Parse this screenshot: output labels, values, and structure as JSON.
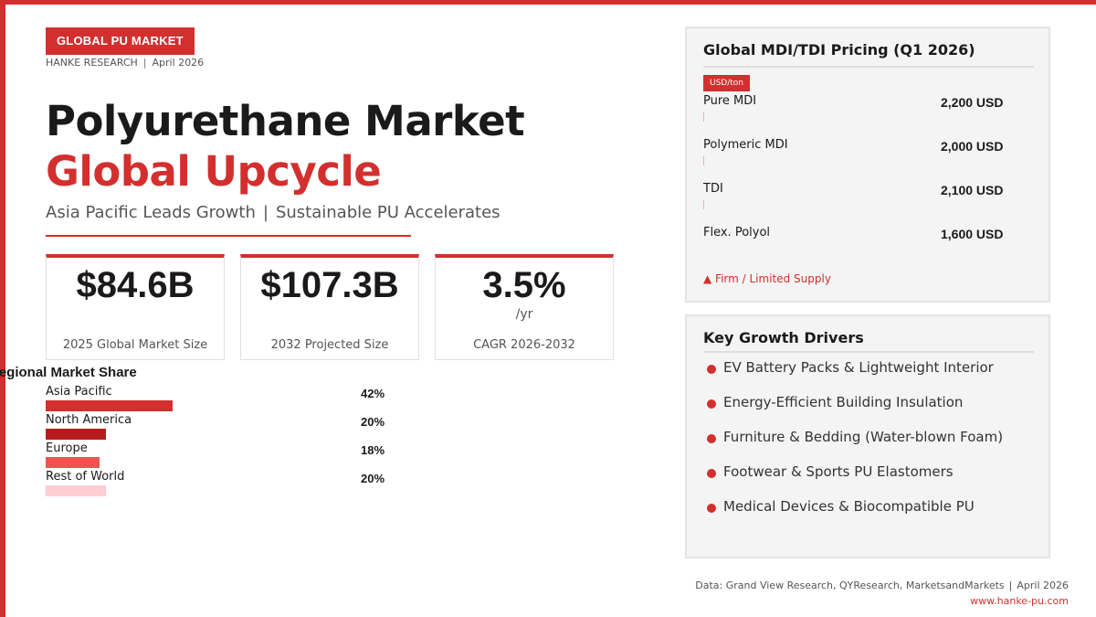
{
  "header": {
    "badge": "GLOBAL PU MARKET",
    "publisher": "HANKE RESEARCH",
    "separator": "|",
    "date": "April 2026"
  },
  "title": {
    "line1": "Polyurethane Market",
    "line2": "Global Upcycle",
    "tagline_left": "Asia Pacific Leads Growth",
    "tagline_sep": "|",
    "tagline_right": "Sustainable PU Accelerates"
  },
  "kpis": [
    {
      "value": "$84.6B",
      "unit": "",
      "label": "2025 Global Market Size"
    },
    {
      "value": "$107.3B",
      "unit": "",
      "label": "2032 Projected Size"
    },
    {
      "value": "3.5%",
      "unit": "/yr",
      "label": "CAGR 2026-2032"
    }
  ],
  "regional_share": {
    "title": "Regional Market Share",
    "regions": [
      {
        "name": "Asia Pacific",
        "share": 42,
        "label": "42%",
        "color": "#d32f2f"
      },
      {
        "name": "North America",
        "share": 20,
        "label": "20%",
        "color": "#b71c1c"
      },
      {
        "name": "Europe",
        "share": 18,
        "label": "18%",
        "color": "#ef5350"
      },
      {
        "name": "Rest of World",
        "share": 20,
        "label": "20%",
        "color": "#ffcdd2"
      }
    ]
  },
  "pricing": {
    "title": "Global MDI/TDI Pricing (Q1 2026)",
    "unit_tag": "USD/ton",
    "items": [
      {
        "name": "Pure MDI",
        "value": "2,200 USD"
      },
      {
        "name": "Polymeric MDI",
        "value": "2,000 USD"
      },
      {
        "name": "TDI",
        "value": "2,100 USD"
      },
      {
        "name": "Flex. Polyol",
        "value": "1,600 USD"
      }
    ],
    "note": "▲ Firm / Limited Supply"
  },
  "drivers": {
    "title": "Key Growth Drivers",
    "items": [
      "EV Battery Packs & Lightweight Interior",
      "Energy-Efficient Building Insulation",
      "Furniture & Bedding (Water-blown Foam)",
      "Footwear & Sports PU Elastomers",
      "Medical Devices & Biocompatible PU"
    ]
  },
  "footer": {
    "sources": "Data: Grand View Research, QYResearch, MarketsandMarkets",
    "separator": "|",
    "date": "April 2026",
    "url": "www.hanke-pu.com"
  },
  "colors": {
    "accent": "#d32f2f",
    "panel_bg": "#f4f4f4",
    "text": "#1a1a1a"
  }
}
